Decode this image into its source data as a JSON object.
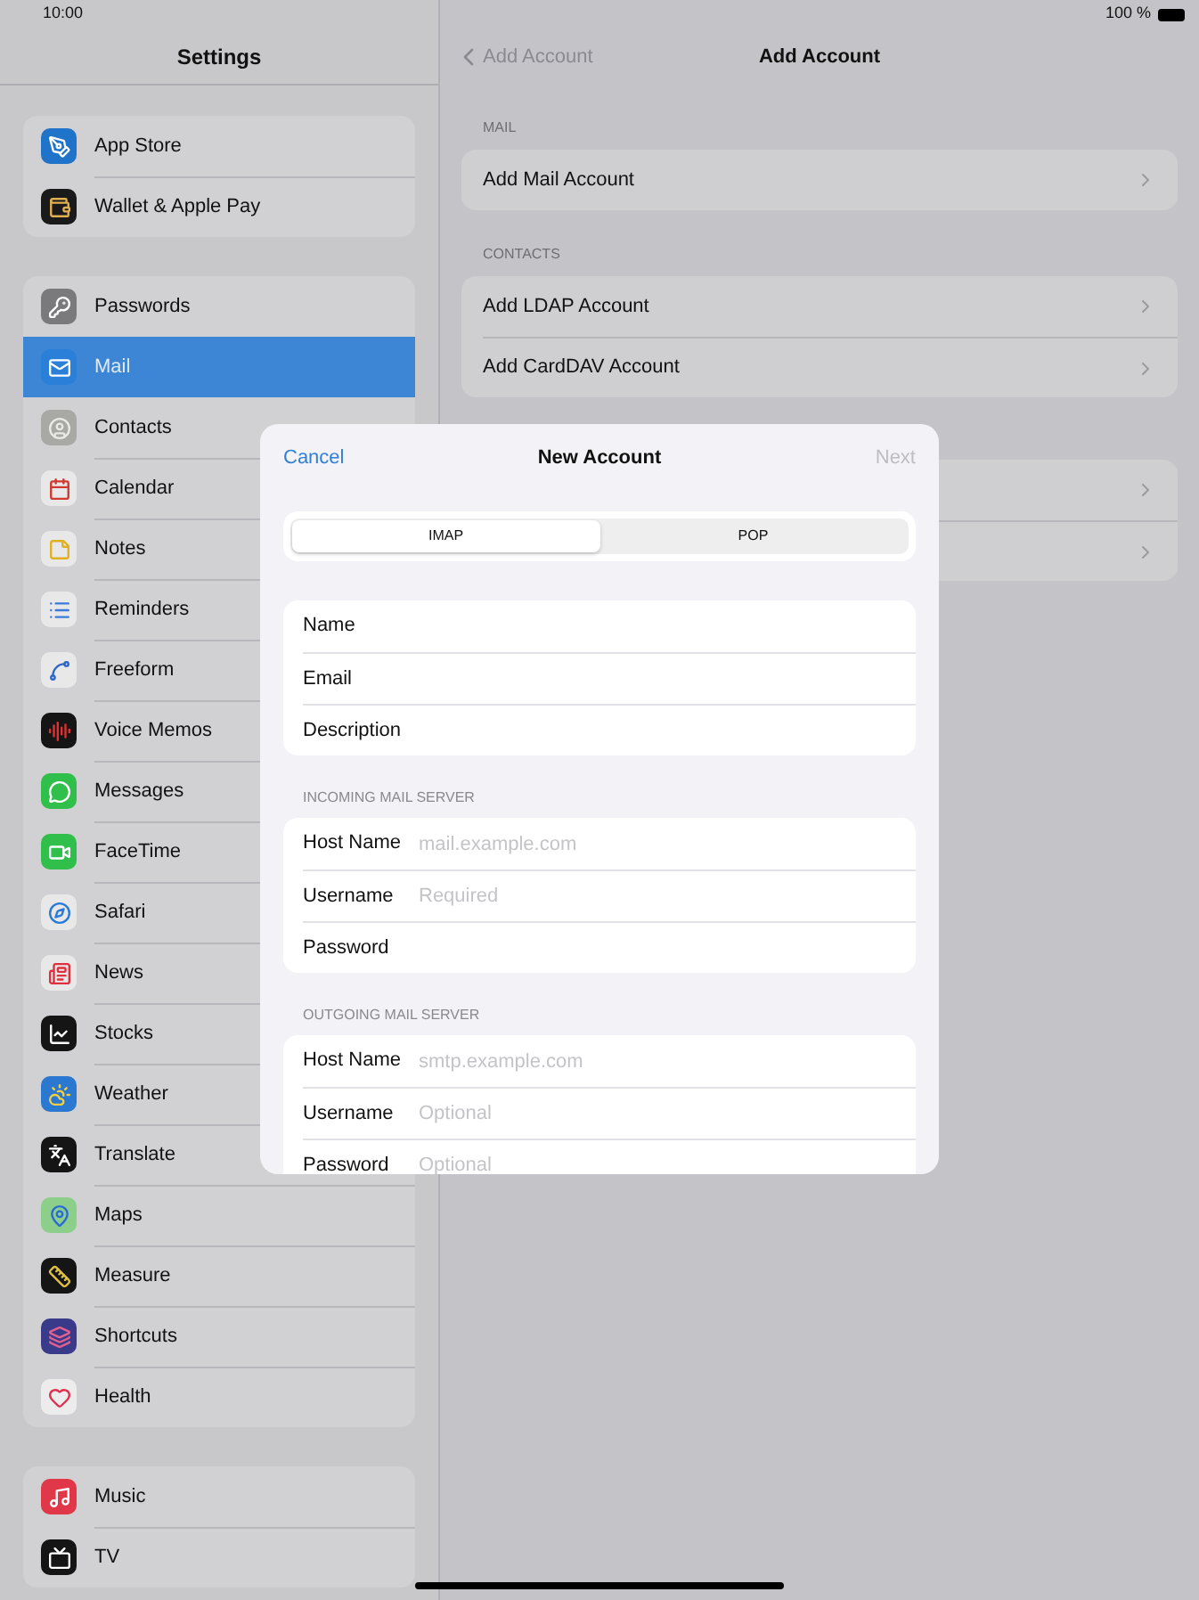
{
  "status_bar": {
    "time": "10:00",
    "battery": "100 %"
  },
  "sidebar": {
    "title": "Settings",
    "groups": [
      {
        "items": [
          {
            "label": "App Store",
            "selected": false
          },
          {
            "label": "Wallet & Apple Pay",
            "selected": false
          }
        ]
      },
      {
        "items": [
          {
            "label": "Passwords",
            "selected": false
          },
          {
            "label": "Mail",
            "selected": true
          },
          {
            "label": "Contacts",
            "selected": false
          },
          {
            "label": "Calendar",
            "selected": false
          },
          {
            "label": "Notes",
            "selected": false
          },
          {
            "label": "Reminders",
            "selected": false
          },
          {
            "label": "Freeform",
            "selected": false
          },
          {
            "label": "Voice Memos",
            "selected": false
          },
          {
            "label": "Messages",
            "selected": false
          },
          {
            "label": "FaceTime",
            "selected": false
          },
          {
            "label": "Safari",
            "selected": false
          },
          {
            "label": "News",
            "selected": false
          },
          {
            "label": "Stocks",
            "selected": false
          },
          {
            "label": "Weather",
            "selected": false
          },
          {
            "label": "Translate",
            "selected": false
          },
          {
            "label": "Maps",
            "selected": false
          },
          {
            "label": "Measure",
            "selected": false
          },
          {
            "label": "Shortcuts",
            "selected": false
          },
          {
            "label": "Health",
            "selected": false
          }
        ]
      },
      {
        "items": [
          {
            "label": "Music",
            "selected": false
          },
          {
            "label": "TV",
            "selected": false
          }
        ]
      }
    ]
  },
  "detail": {
    "back": "Add Account",
    "title": "Add Account",
    "sections": [
      {
        "header": "MAIL",
        "rows": [
          "Add Mail Account"
        ]
      },
      {
        "header": "CONTACTS",
        "rows": [
          "Add LDAP Account",
          "Add CardDAV Account"
        ]
      },
      {
        "rows": [
          "",
          ""
        ]
      }
    ]
  },
  "modal": {
    "cancel": "Cancel",
    "title": "New Account",
    "next": "Next",
    "segments": [
      {
        "label": "IMAP",
        "selected": true
      },
      {
        "label": "POP",
        "selected": false
      }
    ],
    "groups": [
      {
        "fields": [
          {
            "label": "Name"
          },
          {
            "label": "Email"
          },
          {
            "label": "Description"
          }
        ]
      },
      {
        "header": "INCOMING MAIL SERVER",
        "fields": [
          {
            "label": "Host Name",
            "placeholder": "mail.example.com"
          },
          {
            "label": "Username",
            "placeholder": "Required"
          },
          {
            "label": "Password"
          }
        ]
      },
      {
        "header": "OUTGOING MAIL SERVER",
        "fields": [
          {
            "label": "Host Name",
            "placeholder": "smtp.example.com"
          },
          {
            "label": "Username",
            "placeholder": "Optional"
          },
          {
            "label": "Password",
            "placeholder": "Optional"
          }
        ]
      }
    ]
  }
}
